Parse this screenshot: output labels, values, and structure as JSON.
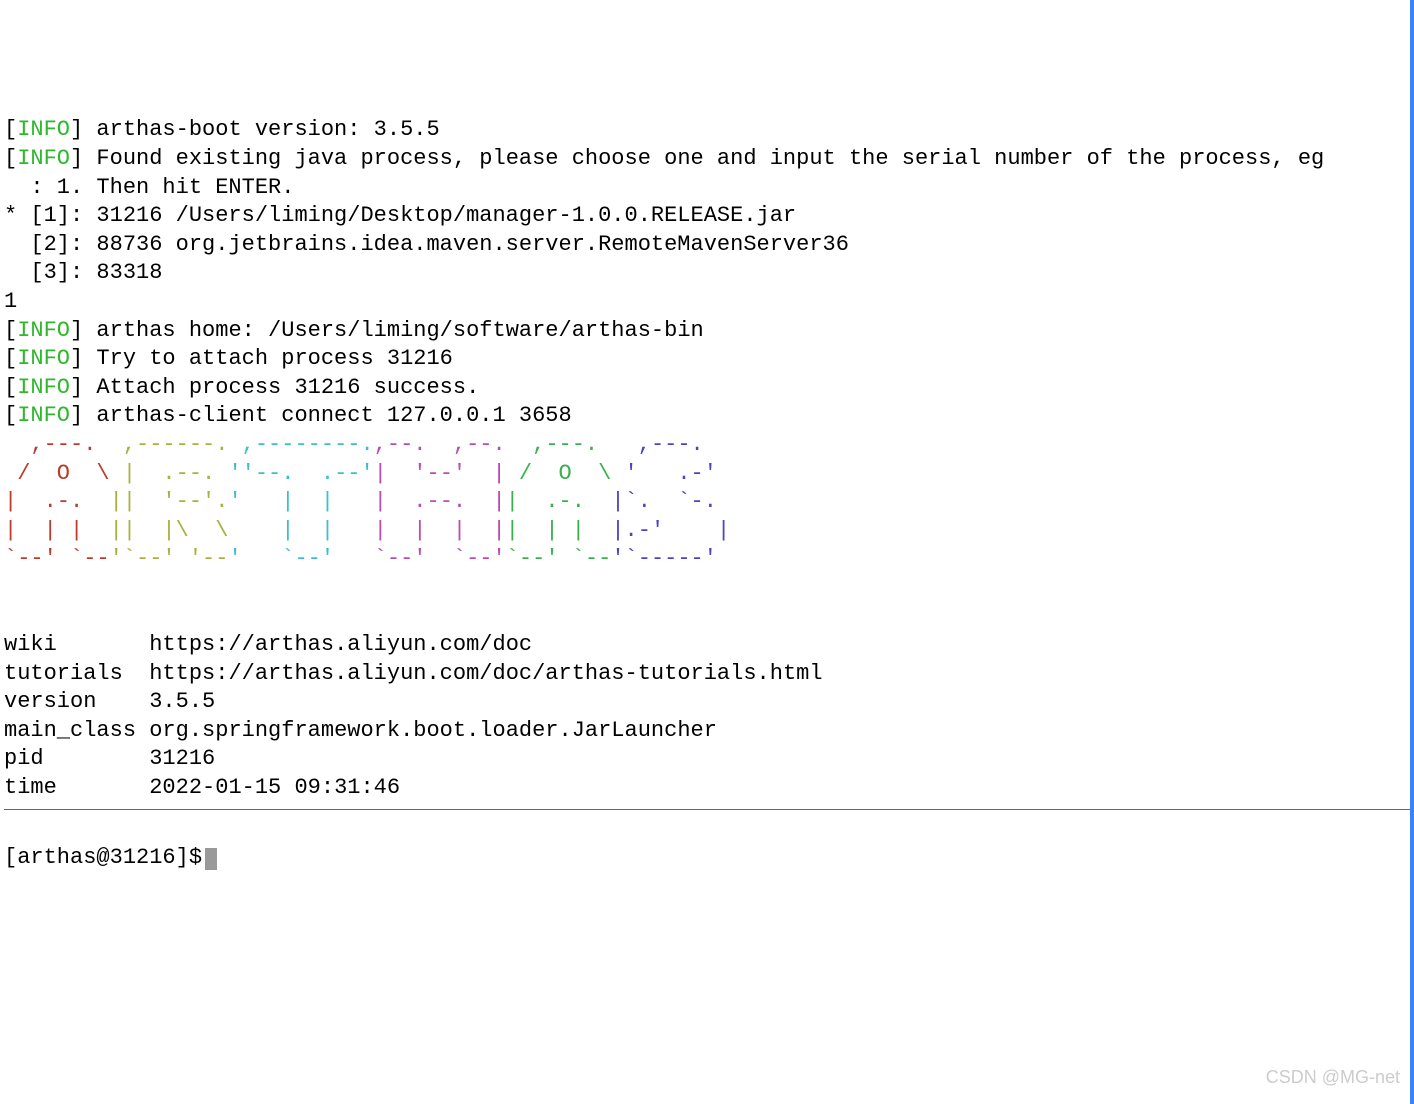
{
  "logs": {
    "info_label": "INFO",
    "line1": "arthas-boot version: 3.5.5",
    "line2": "Found existing java process, please choose one and input the serial number of the process, eg",
    "line2b": "  : 1. Then hit ENTER.",
    "proc1": "* [1]: 31216 /Users/liming/Desktop/manager-1.0.0.RELEASE.jar",
    "proc2": "  [2]: 88736 org.jetbrains.idea.maven.server.RemoteMavenServer36",
    "proc3": "  [3]: 83318",
    "input": "1",
    "line3": "arthas home: /Users/liming/software/arthas-bin",
    "line4": "Try to attach process 31216",
    "line5": "Attach process 31216 success.",
    "line6": "arthas-client connect 127.0.0.1 3658"
  },
  "ascii": {
    "a": [
      "  ,---. ",
      " /  O  \\",
      "|  .-.  ",
      "|  | |  ",
      "`--' `--"
    ],
    "r": [
      " ,------.",
      " |  .--. ",
      "||  '--'.",
      "||  |\\  \\",
      "'`--' '--"
    ],
    "t": [
      " ,--------.",
      "''--.  .--'",
      "'   |  |   ",
      "    |  |   ",
      "'   `--'   "
    ],
    "h": [
      ",--.  ,--.",
      "|  '--'  |",
      "|  .--.  |",
      "|  |  |  |",
      "`--'  `--'"
    ],
    "a2": [
      "  ,---. ",
      " /  O  \\",
      "|  .-.  ",
      "|  | |  ",
      "`--' `--"
    ],
    "s": [
      "  ,---. ",
      " '   .-'",
      "|`.  `-.",
      "|.-'    |",
      "'`-----' "
    ]
  },
  "details": {
    "wiki_label": "wiki",
    "wiki_value": "https://arthas.aliyun.com/doc",
    "tutorials_label": "tutorials",
    "tutorials_value": "https://arthas.aliyun.com/doc/arthas-tutorials.html",
    "version_label": "version",
    "version_value": "3.5.5",
    "main_class_label": "main_class",
    "main_class_value": "org.springframework.boot.loader.JarLauncher",
    "pid_label": "pid",
    "pid_value": "31216",
    "time_label": "time",
    "time_value": "2022-01-15 09:31:46"
  },
  "prompt": "[arthas@31216]$",
  "watermark": "CSDN @MG-net"
}
